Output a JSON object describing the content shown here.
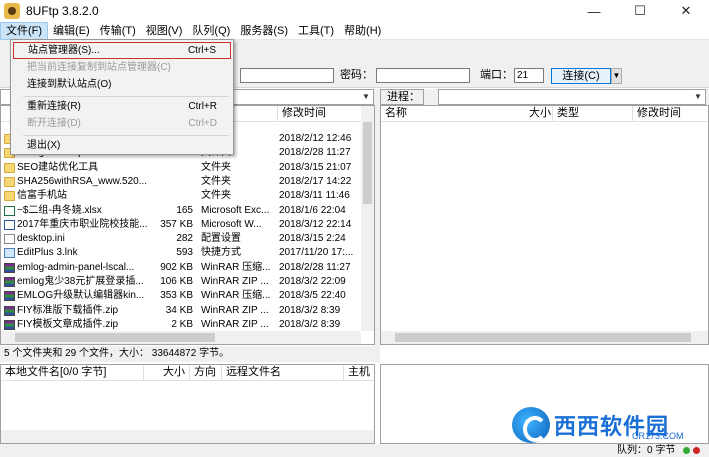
{
  "window": {
    "title": "8UFtp 3.8.2.0",
    "min": "—",
    "max": "☐",
    "close": "✕"
  },
  "menu": [
    {
      "label": "文件(F)"
    },
    {
      "label": "编辑(E)"
    },
    {
      "label": "传输(T)"
    },
    {
      "label": "视图(V)"
    },
    {
      "label": "队列(Q)"
    },
    {
      "label": "服务器(S)"
    },
    {
      "label": "工具(T)"
    },
    {
      "label": "帮助(H)"
    }
  ],
  "file_menu": {
    "site_manager": {
      "label": "站点管理器(S)...",
      "shortcut": "Ctrl+S"
    },
    "copy_to_site": {
      "label": "把当前连接复制到站点管理器(C)"
    },
    "connect_default": {
      "label": "连接到默认站点(O)"
    },
    "reconnect": {
      "label": "重新连接(R)",
      "shortcut": "Ctrl+R"
    },
    "disconnect": {
      "label": "断开连接(D)",
      "shortcut": "Ctrl+D"
    },
    "exit": {
      "label": "退出(X)"
    }
  },
  "connection": {
    "password_label": "密码：",
    "port_label": "端口：",
    "port_value": "21",
    "connect_label": "连接(C)"
  },
  "remote": {
    "process_label": "进程："
  },
  "local_columns": {
    "modified": "修改时间"
  },
  "remote_columns": {
    "name": "名称",
    "size": "大小",
    "type": "类型",
    "modified": "修改时间"
  },
  "local_files": [
    {
      "name": "",
      "size": "",
      "type": "",
      "modified": "2018/2/12 12:46",
      "icon": "folder"
    },
    {
      "name": "emlog-admin-panel-lscal...",
      "size": "",
      "type": "文件夹",
      "modified": "2018/2/28 11:27",
      "icon": "folder"
    },
    {
      "name": "SEO建站优化工具",
      "size": "",
      "type": "文件夹",
      "modified": "2018/3/15 21:07",
      "icon": "folder"
    },
    {
      "name": "SHA256withRSA_www.520...",
      "size": "",
      "type": "文件夹",
      "modified": "2018/2/17 14:22",
      "icon": "folder"
    },
    {
      "name": "信富手机站",
      "size": "",
      "type": "文件夹",
      "modified": "2018/3/11 11:46",
      "icon": "folder"
    },
    {
      "name": "~$二组-冉冬娆.xlsx",
      "size": "165",
      "type": "Microsoft Exc...",
      "modified": "2018/1/6 22:04",
      "icon": "xlsx"
    },
    {
      "name": "2017年重庆市职业院校技能...",
      "size": "357 KB",
      "type": "Microsoft W...",
      "modified": "2018/3/12 22:14",
      "icon": "word"
    },
    {
      "name": "desktop.ini",
      "size": "282",
      "type": "配置设置",
      "modified": "2018/3/15 2:24",
      "icon": "ini"
    },
    {
      "name": "EditPlus 3.lnk",
      "size": "593",
      "type": "快捷方式",
      "modified": "2017/11/20 17:...",
      "icon": "lnk"
    },
    {
      "name": "emlog-admin-panel-lscal...",
      "size": "902 KB",
      "type": "WinRAR 压缩...",
      "modified": "2018/2/28 11:27",
      "icon": "rar"
    },
    {
      "name": "emlog鬼少38元扩展登录插...",
      "size": "106 KB",
      "type": "WinRAR ZIP ...",
      "modified": "2018/3/2 22:09",
      "icon": "rar"
    },
    {
      "name": "EMLOG升级默认编辑器kin...",
      "size": "353 KB",
      "type": "WinRAR 压缩...",
      "modified": "2018/3/5 22:40",
      "icon": "rar"
    },
    {
      "name": "FIY标准版下载插件.zip",
      "size": "34 KB",
      "type": "WinRAR ZIP ...",
      "modified": "2018/3/2 8:39",
      "icon": "rar"
    },
    {
      "name": "FIY模板文章成插件.zip",
      "size": "2 KB",
      "type": "WinRAR ZIP ...",
      "modified": "2018/3/2 8:39",
      "icon": "rar"
    }
  ],
  "local_status": "5 个文件夹和 29 个文件，大小： 33644872 字节。",
  "queue_columns": {
    "local_file": "本地文件名[0/0 字节]",
    "size": "大小",
    "direction": "方向",
    "remote_file": "远程文件名",
    "host": "主机"
  },
  "bottom_status": {
    "queue": "队列：0 字节"
  },
  "watermark": {
    "text": "西西软件园",
    "url": "CR173.COM"
  }
}
